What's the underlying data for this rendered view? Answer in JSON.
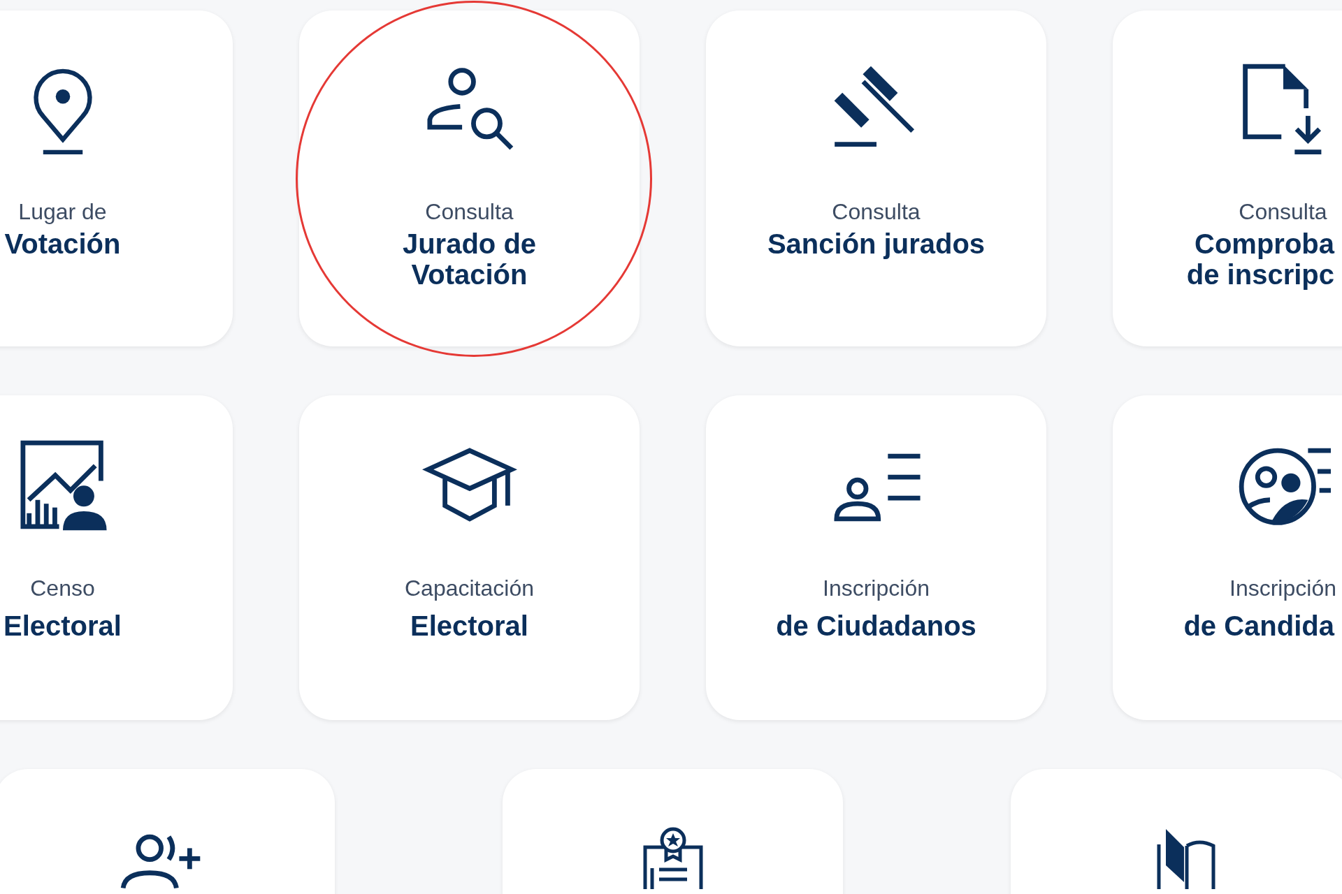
{
  "rows": [
    {
      "cards": [
        {
          "subtitle": "Lugar de",
          "title": [
            "Votación"
          ],
          "highlighted": false
        },
        {
          "subtitle": "Consulta",
          "title": [
            "Jurado de",
            "Votación"
          ],
          "highlighted": true
        },
        {
          "subtitle": "Consulta",
          "title": [
            "Sanción jurados"
          ],
          "highlighted": false
        },
        {
          "subtitle": "Consulta",
          "title": [
            "Comproba",
            "de inscripc"
          ],
          "highlighted": false
        }
      ]
    },
    {
      "cards": [
        {
          "subtitle": "Censo",
          "title": [
            "Electoral"
          ],
          "highlighted": false
        },
        {
          "subtitle": "Capacitación",
          "title": [
            "Electoral"
          ],
          "highlighted": false
        },
        {
          "subtitle": "Inscripción",
          "title": [
            "de Ciudadanos"
          ],
          "highlighted": false
        },
        {
          "subtitle": "Inscripción",
          "title": [
            "de Candida"
          ],
          "highlighted": false
        }
      ]
    },
    {
      "cards": [
        {
          "highlighted": false
        },
        {
          "highlighted": false
        },
        {
          "highlighted": false
        }
      ]
    }
  ]
}
